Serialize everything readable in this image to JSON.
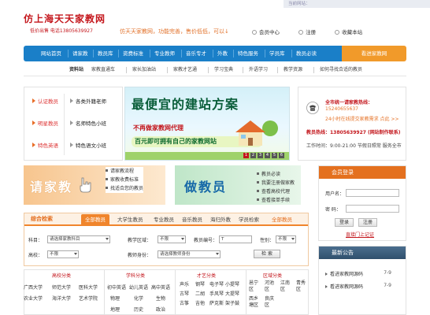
{
  "header": {
    "logo_title": "仿上海天天家教网",
    "logo_sub": "低价出售 电话13805639927",
    "top_right": "当前网站：",
    "slogan": "仿天天家教网，功能完善，售价低低，可以↓",
    "links": [
      "会员中心",
      "注册",
      "收藏本站"
    ]
  },
  "nav": {
    "items": [
      "网站首页",
      "请家教",
      "教员库",
      "资费标准",
      "专业教师",
      "音乐专才",
      "外教",
      "特色服务",
      "学员库",
      "教员必读"
    ],
    "orange": "看进家教网"
  },
  "subnav": {
    "label": "资料站",
    "items": [
      "家教直通车",
      "家长加油站",
      "家教才艺通",
      "学习宝典",
      "外语学习",
      "教学资源",
      "如何寻找合适的教员"
    ]
  },
  "left_panel": {
    "rows": [
      {
        "a": "认证教员",
        "b": "各类外籍老师"
      },
      {
        "a": "明星教员",
        "b": "名师特色小班"
      },
      {
        "a": "特色英语",
        "b": "特色语文小班"
      }
    ]
  },
  "banner": {
    "headline": "最便宜的建站方案",
    "line1": "不再做家教网代理",
    "line2": "百元即可拥有自己的家教网站",
    "pages": [
      "1",
      "2",
      "3",
      "4",
      "5",
      "6"
    ]
  },
  "info": {
    "l1": "全市统一请家教热线：",
    "l2": "15240655637",
    "l3": "24小时在线提交家教需求  点此 >>",
    "l4": "教员热线：13805639927  (网站制作联系)",
    "l5": "工作时间：9:00-21:00  节假日照常  服务全市"
  },
  "please": {
    "title": "请家教",
    "items": [
      "请家教流程",
      "家教收费标准",
      "找适合您的教员"
    ]
  },
  "teach": {
    "title": "做教员",
    "items": [
      "教员必读",
      "我要注册做家教",
      "查看高校代理",
      "查看接单手续"
    ]
  },
  "login": {
    "title": "会员登录",
    "user_label": "用户名：",
    "pass_label": "密  码：",
    "login_btn": "登录",
    "reset_btn": "注册",
    "forgot": "直接门上记证"
  },
  "search": {
    "title": "综合检索",
    "tabs": [
      "全部教员",
      "大学生教员",
      "专业教员",
      "音乐教员",
      "海归外教",
      "学员检索",
      "全部教员"
    ],
    "subject_label": "科目：",
    "subject_value": "请选择家教科目",
    "area_label": "教学区域：",
    "area_value": "不限",
    "id_label": "教员编号：",
    "id_value": "T",
    "gender_label": "性别：",
    "gender_value": "不限",
    "school_label": "高校：",
    "school_value": "不限",
    "identity_label": "教师身份：",
    "identity_value": "请选择教师身份",
    "search_btn": "检 索"
  },
  "categories": {
    "headers": [
      "高校分类",
      "学科分类",
      "才艺分类",
      "区域分类"
    ],
    "schools": [
      "广西大学",
      "师范大学",
      "医科大学",
      "农业大学",
      "海洋大学",
      "艺术学院"
    ],
    "subjects": [
      "初中英语",
      "幼儿英语",
      "高中英语",
      "物理",
      "化学",
      "生物",
      "地理",
      "历史",
      "政治"
    ],
    "talents": [
      "声乐",
      "钢琴",
      "电子琴",
      "小提琴",
      "古琴",
      "二胡",
      "手风琴",
      "大提琴",
      "古筝",
      "吉他",
      "萨克斯",
      "架子鼓"
    ],
    "areas": [
      "邕宁区",
      "河池区",
      "江南区",
      "青秀区",
      "西乡塘区",
      "良庆区"
    ]
  },
  "notice": {
    "title": "最新公告",
    "items": [
      {
        "text": "看进家教网源码",
        "date": "7-9"
      },
      {
        "text": "看进家教网源码",
        "date": "7-9"
      }
    ]
  }
}
